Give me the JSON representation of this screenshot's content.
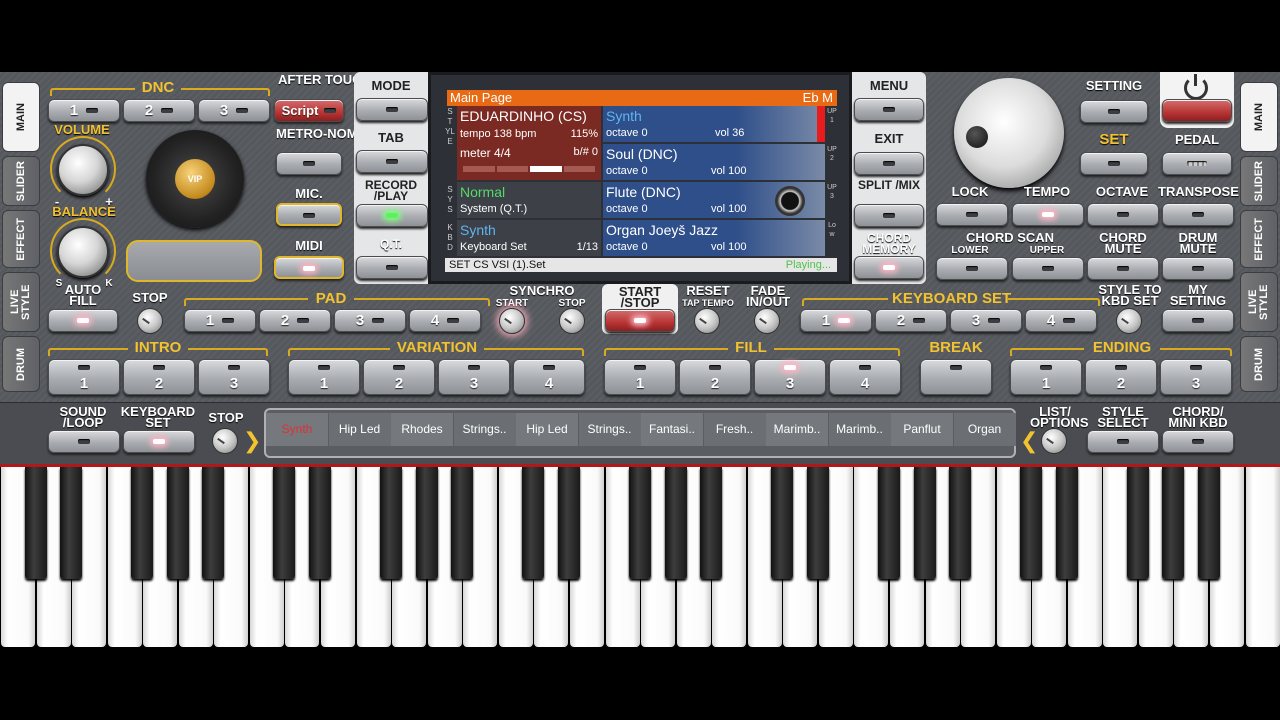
{
  "left_tabs": [
    "MAIN",
    "SLIDER",
    "EFFECT",
    "LIVE STYLE",
    "DRUM"
  ],
  "right_tabs": [
    "MAIN",
    "SLIDER",
    "EFFECT",
    "LIVE STYLE",
    "DRUM"
  ],
  "dnc": {
    "title": "DNC",
    "buttons": [
      "1",
      "2",
      "3"
    ],
    "script_label": "Script"
  },
  "labels": {
    "after_touch": "AFTER TOUCH",
    "metronome": "METRO-NOME",
    "mic": "MIC.",
    "midi": "MIDI",
    "volume": "VOLUME",
    "balance": "BALANCE",
    "vol_minus": "-",
    "vol_plus": "+",
    "bal_s": "S",
    "bal_k": "K",
    "vip": "VIP",
    "mode": "MODE",
    "tab": "TAB",
    "record_play": "RECORD /PLAY",
    "qt": "Q.T.",
    "menu": "MENU",
    "exit": "EXIT",
    "split_mix": "SPLIT /MIX",
    "chord_memory": "CHORD MEMORY",
    "setting": "SETTING",
    "set": "SET",
    "pedal": "PEDAL",
    "lock": "LOCK",
    "tempo": "TEMPO",
    "octave": "OCTAVE",
    "transpose": "TRANSPOSE",
    "chord_scan": "CHORD SCAN",
    "lower": "LOWER",
    "upper": "UPPER",
    "chord_mute": "CHORD MUTE",
    "drum_mute": "DRUM MUTE",
    "auto_fill": "AUTO FILL",
    "stop": "STOP",
    "pad": "PAD",
    "synchro": "SYNCHRO",
    "synchro_start": "START",
    "synchro_stop": "STOP",
    "start_stop": "START /STOP",
    "reset": "RESET",
    "tap_tempo": "TAP TEMPO",
    "fade": "FADE IN/OUT",
    "keyboard_set": "KEYBOARD SET",
    "style_to_kbd": "STYLE TO KBD SET",
    "my_setting": "MY SETTING",
    "intro": "INTRO",
    "variation": "VARIATION",
    "fill": "FILL",
    "break": "BREAK",
    "ending": "ENDING",
    "sound_loop": "SOUND /LOOP",
    "keyboard_set2": "KEYBOARD SET",
    "stop2": "STOP",
    "list_options": "LIST/ OPTIONS",
    "style_select": "STYLE SELECT",
    "chord_mini_kbd": "CHORD/ MINI KBD"
  },
  "pad_buttons": [
    "1",
    "2",
    "3",
    "4"
  ],
  "kbdset_buttons": [
    "1",
    "2",
    "3",
    "4"
  ],
  "intro_buttons": [
    "1",
    "2",
    "3"
  ],
  "variation_buttons": [
    "1",
    "2",
    "3",
    "4"
  ],
  "fill_buttons": [
    "1",
    "2",
    "3",
    "4"
  ],
  "ending_buttons": [
    "1",
    "2",
    "3"
  ],
  "screen": {
    "title": "Main Page",
    "key": "Eb M",
    "side_style": "STYLE",
    "side_sys": "SYS",
    "side_kbd": "KBD",
    "style_name": "EDUARDINHO (CS)",
    "tempo": "tempo 138 bpm",
    "tempo_pct": "115%",
    "meter": "meter 4/4",
    "transpose": "b/# 0",
    "sys_name": "Normal",
    "sys_sub": "System (Q.T.)",
    "kbd_name": "Synth",
    "kbd_sub": "Keyboard Set",
    "kbd_count": "1/13",
    "parts": [
      {
        "name": "Synth",
        "octave": "octave 0",
        "vol": "vol 36",
        "side": "UP1"
      },
      {
        "name": "Soul (DNC)",
        "octave": "octave 0",
        "vol": "vol 100",
        "side": "UP2"
      },
      {
        "name": "Flute (DNC)",
        "octave": "octave 0",
        "vol": "vol 100",
        "side": "UP3"
      },
      {
        "name": "Organ Joeyš Jazz",
        "octave": "octave 0",
        "vol": "vol 100",
        "side": "Low"
      }
    ],
    "footer_file": "SET CS VSI (1).Set",
    "footer_status": "Playing..."
  },
  "sounds": [
    "Synth",
    "Hip Led",
    "Rhodes",
    "Strings..",
    "Hip Led",
    "Strings..",
    "Fantasi..",
    "Fresh..",
    "Marimb..",
    "Marimb..",
    "Panflut",
    "Organ"
  ],
  "colors": {
    "accent": "#f2c230",
    "screen_header": "#e86a14",
    "active_sound": "#e03030",
    "playing": "#4ec24e"
  }
}
